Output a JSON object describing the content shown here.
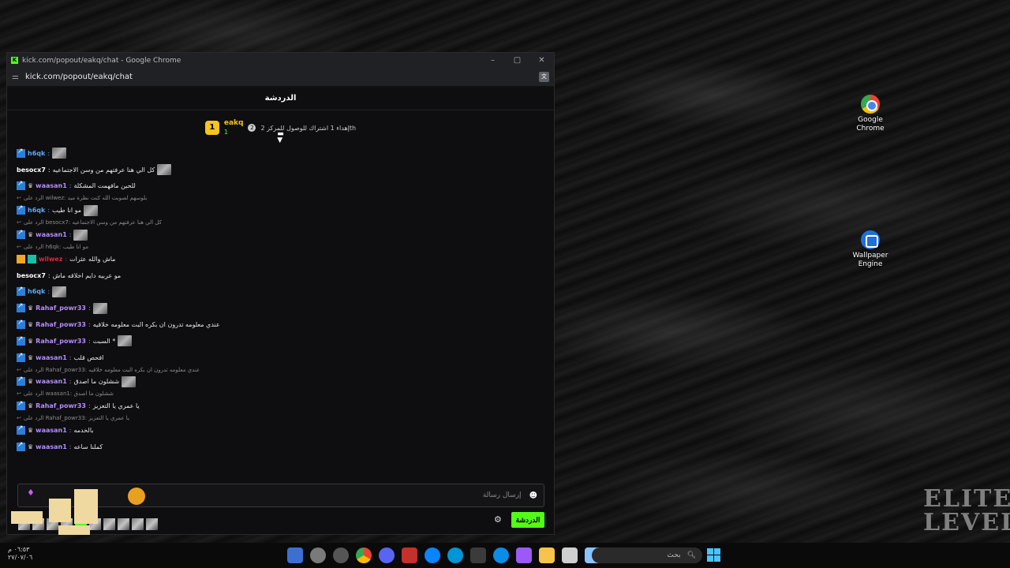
{
  "window": {
    "title": "kick.com/popout/eakq/chat - Google Chrome",
    "url": "kick.com/popout/eakq/chat",
    "favicon": "K"
  },
  "chat": {
    "header": "الدردشة",
    "pinned": {
      "username": "eakq",
      "count": "1",
      "text": "إهداء 1 اشتراك للوصول للمركز 2",
      "suffix": "th",
      "step": "2"
    },
    "input_placeholder": "إرسال رسالة",
    "send_label": "الدردشة"
  },
  "messages": [
    {
      "kind": "msg",
      "user": "h6qk",
      "color": "blue",
      "text": ""
    },
    {
      "kind": "msg",
      "user": "besocx7",
      "color": "white",
      "text": "كل الي هنا عرفتهم من وسن الاجتماعيه",
      "no_badge": true
    },
    {
      "kind": "msg",
      "user": "waasan1",
      "color": "purple",
      "text": "للحين مافهمت المشكلة"
    },
    {
      "kind": "reply",
      "text": "الرد على wilwez: بلوسهم لصوبت الله كنت نظرة ميد"
    },
    {
      "kind": "msg",
      "user": "h6qk",
      "color": "blue",
      "text": "مو انا طيب"
    },
    {
      "kind": "reply",
      "text": "الرد على besocx7: كل الي هنا عرفتهم من وسن الاجتماعيه"
    },
    {
      "kind": "msg",
      "user": "waasan1",
      "color": "purple",
      "text": ""
    },
    {
      "kind": "reply",
      "text": "الرد على h6qk: مو انا طيب"
    },
    {
      "kind": "msg",
      "user": "wilwez",
      "color": "red",
      "text": "ماش والله عثرات",
      "gold": true
    },
    {
      "kind": "msg",
      "user": "besocx7",
      "color": "white",
      "text": "مو عربيه دايم اخلاقه ماش",
      "no_badge": true
    },
    {
      "kind": "msg",
      "user": "h6qk",
      "color": "blue",
      "text": ""
    },
    {
      "kind": "msg",
      "user": "Rahaf_powr33",
      "color": "purple",
      "text": ""
    },
    {
      "kind": "msg",
      "user": "Rahaf_powr33",
      "color": "purple",
      "text": "عندي معلومه تدرون ان بكره البت معلومه خلاقيه"
    },
    {
      "kind": "msg",
      "user": "Rahaf_powr33",
      "color": "purple",
      "text": "السبت *"
    },
    {
      "kind": "msg",
      "user": "waasan1",
      "color": "purple",
      "text": "افحص قلب"
    },
    {
      "kind": "reply",
      "text": "الرد على Rahaf_powr33: عندي معلومه تدرون ان بكره البت معلومه خلاقيه"
    },
    {
      "kind": "msg",
      "user": "waasan1",
      "color": "purple",
      "text": "ششلون ما اصدق"
    },
    {
      "kind": "reply",
      "text": "الرد على waasan1: ششلون ما اصدق"
    },
    {
      "kind": "msg",
      "user": "Rahaf_powr33",
      "color": "purple",
      "text": "يا عمري يا التعزيز"
    },
    {
      "kind": "reply",
      "text": "الرد على Rahaf_powr33: يا عمري يا التعزيز"
    },
    {
      "kind": "msg",
      "user": "waasan1",
      "color": "purple",
      "text": "بالخدمه"
    },
    {
      "kind": "msg",
      "user": "waasan1",
      "color": "purple",
      "text": "كملنا ساعه"
    }
  ],
  "desktop": {
    "icons": [
      {
        "label_1": "Google",
        "label_2": "Chrome",
        "icon": "chrome-icon"
      },
      {
        "label_1": "Wallpaper",
        "label_2": "Engine",
        "icon": "wallpaper-engine-icon"
      }
    ]
  },
  "taskbar": {
    "search_placeholder": "بحث",
    "clock_time": "٠٦:٥٣ م",
    "clock_date": "٢٧/٠٧/٠٦"
  },
  "overlay": {
    "elite_line1": "ELITE",
    "elite_line2": "LEVEL"
  },
  "colors": {
    "kick_green": "#53fc18",
    "accent_blue": "#5aa9ff",
    "accent_purple": "#b58cff",
    "accent_red": "#e0283a",
    "gold": "#f5c518"
  }
}
